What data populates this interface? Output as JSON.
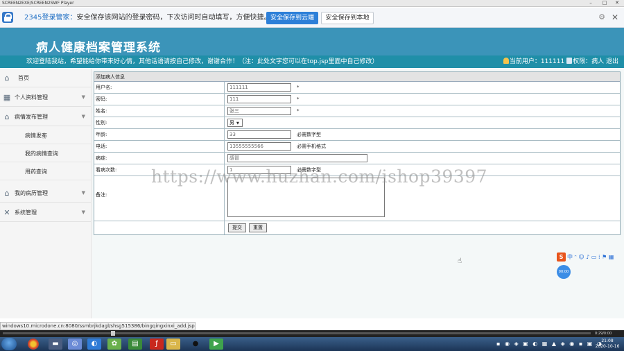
{
  "window": {
    "title": "SCREEN2EXE/SCREEN2SWF Player",
    "min": "–",
    "max": "□",
    "close": "✕"
  },
  "password_bar": {
    "brand": "2345登录管家：",
    "message": "安全保存该网站的登录密码，下次访问时自动填写，方便快捷。",
    "save_cloud": "安全保存到云端",
    "save_local": "安全保存到本地",
    "icons": [
      "lock-icon",
      "gear-icon",
      "close-icon"
    ]
  },
  "header": {
    "title": "病人健康档案管理系统",
    "welcome": "欢迎登陆我站，希望能给你带来好心情，其他话语请按自己修改，谢谢合作！（注：此处文字您可以在top.jsp里面中自己修改）",
    "current_user_label": "当前用户：",
    "current_user": "111111",
    "role_label": "权限：",
    "role": "病人",
    "logout": "退出"
  },
  "sidebar": {
    "items": [
      {
        "label": "首页",
        "icon": "home-icon"
      },
      {
        "label": "个人资料管理",
        "icon": "grid-icon"
      },
      {
        "label": "病情发布管理",
        "icon": "home-icon"
      },
      {
        "label": "我的病历管理",
        "icon": "home-icon"
      },
      {
        "label": "系统管理",
        "icon": "tools-icon"
      }
    ],
    "subitems": [
      {
        "label": "病情发布"
      },
      {
        "label": "我的病情查询"
      },
      {
        "label": "用药查询"
      }
    ]
  },
  "form": {
    "caption": "添加病人信息",
    "fields": [
      {
        "label": "用户名:",
        "value": "111111",
        "note": "*"
      },
      {
        "label": "密码:",
        "value": "111",
        "note": "*"
      },
      {
        "label": "姓名:",
        "value": "张三",
        "note": "*"
      },
      {
        "label": "性别:",
        "value": "男"
      },
      {
        "label": "年龄:",
        "value": "33",
        "note": "必需数字型"
      },
      {
        "label": "电话:",
        "value": "13555555566",
        "note": "必需手机格式"
      },
      {
        "label": "病症:",
        "value": "感冒"
      },
      {
        "label": "看病次数:",
        "value": "1",
        "note": "必需数字型"
      },
      {
        "label": "备注:",
        "value": ""
      }
    ],
    "submit": "提交",
    "reset": "重置"
  },
  "watermark": "https://www.huzhan.com/ishop39397",
  "ime": {
    "logo": "S",
    "items": "中 ᵔ ☺ ♪ ▭ ⁞ ⚑ ▦"
  },
  "bubble": "00:00",
  "status_url": "windows10.microdone.cn:8080/ssmbrjkdagl/shsg515386/bingqingxinxi_add.jsp",
  "player": {
    "time": "0:29/0:00"
  },
  "taskbar": {
    "apps": [
      "chrome-icon",
      "folder-icon",
      "media-icon",
      "browser-icon",
      "paint-icon",
      "flash-icon",
      "explorer-icon",
      "qq-icon",
      "player-icon"
    ],
    "tray": "▪ ◉ ◈ ▣ ◐ ▦ ▲ ◈ ◉ ▪ ▣ ◑",
    "time": "21:08",
    "date": "2020-10-16"
  }
}
